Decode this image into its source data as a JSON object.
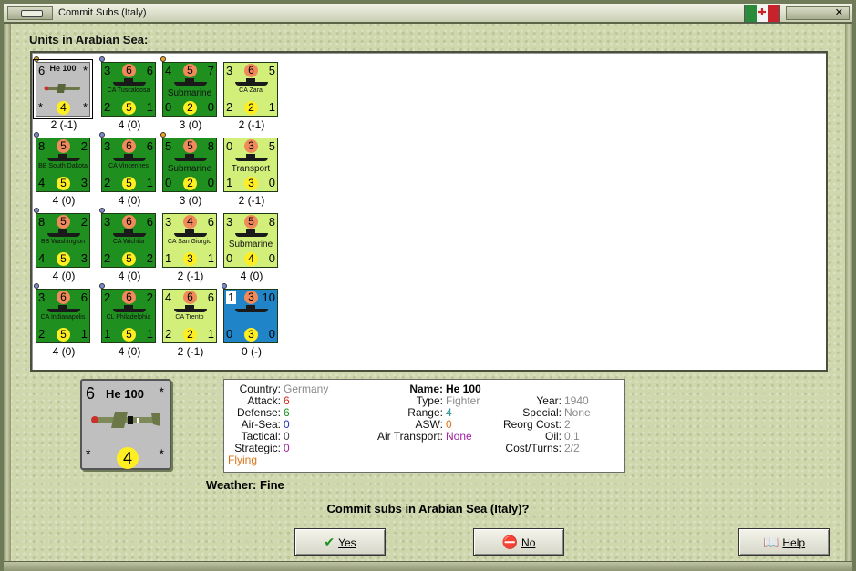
{
  "window": {
    "title": "Commit Subs (Italy)"
  },
  "heading": "Units in Arabian Sea:",
  "units": [
    {
      "tl": "6",
      "top": "",
      "tr": "*",
      "bl": "*",
      "bot": "4",
      "br": "*",
      "name": "He 100",
      "value": "2 (-1)",
      "color": "grey",
      "kind": "plane",
      "dot": "orange"
    },
    {
      "tl": "3",
      "top": "6",
      "tr": "6",
      "bl": "2",
      "bot": "5",
      "br": "1",
      "name": "CA Tuscaloosa",
      "value": "4 (0)",
      "color": "green",
      "kind": "ship",
      "dot": "blue"
    },
    {
      "tl": "4",
      "top": "5",
      "tr": "7",
      "bl": "0",
      "bot": "2",
      "br": "0",
      "name": "Submarine",
      "value": "3 (0)",
      "color": "green",
      "kind": "sub",
      "dot": "orange"
    },
    {
      "tl": "3",
      "top": "6",
      "tr": "5",
      "bl": "2",
      "bot": "2",
      "br": "1",
      "name": "CA Zara",
      "value": "2 (-1)",
      "color": "light",
      "kind": "ship",
      "dot": ""
    },
    {
      "tl": "8",
      "top": "5",
      "tr": "2",
      "bl": "4",
      "bot": "5",
      "br": "3",
      "name": "BB South Dakota",
      "value": "4 (0)",
      "color": "green",
      "kind": "ship",
      "dot": "blue"
    },
    {
      "tl": "3",
      "top": "6",
      "tr": "6",
      "bl": "2",
      "bot": "5",
      "br": "1",
      "name": "CA Vincennes",
      "value": "4 (0)",
      "color": "green",
      "kind": "ship",
      "dot": "blue"
    },
    {
      "tl": "5",
      "top": "5",
      "tr": "8",
      "bl": "0",
      "bot": "2",
      "br": "0",
      "name": "Submarine",
      "value": "3 (0)",
      "color": "green",
      "kind": "sub",
      "dot": "orange"
    },
    {
      "tl": "0",
      "top": "3",
      "tr": "5",
      "bl": "1",
      "bot": "3",
      "br": "0",
      "name": "Transport",
      "value": "2 (-1)",
      "color": "light",
      "kind": "sub",
      "dot": ""
    },
    {
      "tl": "8",
      "top": "5",
      "tr": "2",
      "bl": "4",
      "bot": "5",
      "br": "3",
      "name": "BB Washington",
      "value": "4 (0)",
      "color": "green",
      "kind": "ship",
      "dot": "blue"
    },
    {
      "tl": "3",
      "top": "6",
      "tr": "6",
      "bl": "2",
      "bot": "5",
      "br": "2",
      "name": "CA Wichita",
      "value": "4 (0)",
      "color": "green",
      "kind": "ship",
      "dot": "blue"
    },
    {
      "tl": "3",
      "top": "4",
      "tr": "6",
      "bl": "1",
      "bot": "3",
      "br": "1",
      "name": "CA San Giorgio",
      "value": "2 (-1)",
      "color": "light",
      "kind": "ship",
      "dot": ""
    },
    {
      "tl": "3",
      "top": "5",
      "tr": "8",
      "bl": "0",
      "bot": "4",
      "br": "0",
      "name": "Submarine",
      "value": "4 (0)",
      "color": "light",
      "kind": "sub",
      "dot": ""
    },
    {
      "tl": "3",
      "top": "6",
      "tr": "6",
      "bl": "2",
      "bot": "5",
      "br": "1",
      "name": "CA Indianapolis",
      "value": "4 (0)",
      "color": "green",
      "kind": "ship",
      "dot": "blue"
    },
    {
      "tl": "2",
      "top": "6",
      "tr": "2",
      "bl": "1",
      "bot": "5",
      "br": "1",
      "name": "CL Philadelphia",
      "value": "4 (0)",
      "color": "green",
      "kind": "ship",
      "dot": "blue"
    },
    {
      "tl": "4",
      "top": "6",
      "tr": "6",
      "bl": "2",
      "bot": "2",
      "br": "1",
      "name": "CA Trento",
      "value": "2 (-1)",
      "color": "light",
      "kind": "ship",
      "dot": ""
    },
    {
      "tl": "1",
      "top": "3",
      "tr": "10",
      "bl": "0",
      "bot": "3",
      "br": "0",
      "name": "",
      "value": "0 (-)",
      "color": "blue",
      "kind": "ship",
      "dot": "blue"
    }
  ],
  "detail": {
    "counter": {
      "tl": "6",
      "name": "He 100",
      "tr": "*",
      "bl": "*",
      "bot": "4",
      "br": "*"
    },
    "col1": [
      {
        "label": "Country:",
        "value": "Germany",
        "color": "#8a8a8a"
      },
      {
        "label": "Attack:",
        "value": "6",
        "color": "#cc2a1a"
      },
      {
        "label": "Defense:",
        "value": "6",
        "color": "#1f8f1f"
      },
      {
        "label": "Air-Sea:",
        "value": "0",
        "color": "#1f2fb0"
      },
      {
        "label": "Tactical:",
        "value": "0",
        "color": "#444"
      },
      {
        "label": "Strategic:",
        "value": "0",
        "color": "#a020a0"
      }
    ],
    "extra": {
      "value": "Flying",
      "color": "#d9751a"
    },
    "col2": [
      {
        "label": "Name:",
        "value": "He 100",
        "color": "#000",
        "bold": true
      },
      {
        "label": "Type:",
        "value": "Fighter",
        "color": "#8a8a8a"
      },
      {
        "label": "Range:",
        "value": "4",
        "color": "#1f8f8f"
      },
      {
        "label": "ASW:",
        "value": "0",
        "color": "#d9751a"
      },
      {
        "label": "Air Transport:",
        "value": "None",
        "color": "#a020a0"
      }
    ],
    "col3": [
      {
        "label": "",
        "value": "",
        "color": "#000"
      },
      {
        "label": "Year:",
        "value": "1940",
        "color": "#8a8a8a"
      },
      {
        "label": "Special:",
        "value": "None",
        "color": "#8a8a8a"
      },
      {
        "label": "Reorg Cost:",
        "value": "2",
        "color": "#8a8a8a"
      },
      {
        "label": "Oil:",
        "value": "0,1",
        "color": "#8a8a8a"
      },
      {
        "label": "Cost/Turns:",
        "value": "2/2",
        "color": "#8a8a8a"
      }
    ]
  },
  "weather": {
    "label": "Weather:",
    "value": "Fine"
  },
  "question": "Commit subs in Arabian Sea (Italy)?",
  "buttons": {
    "yes": "Yes",
    "no": "No",
    "help": "Help"
  }
}
